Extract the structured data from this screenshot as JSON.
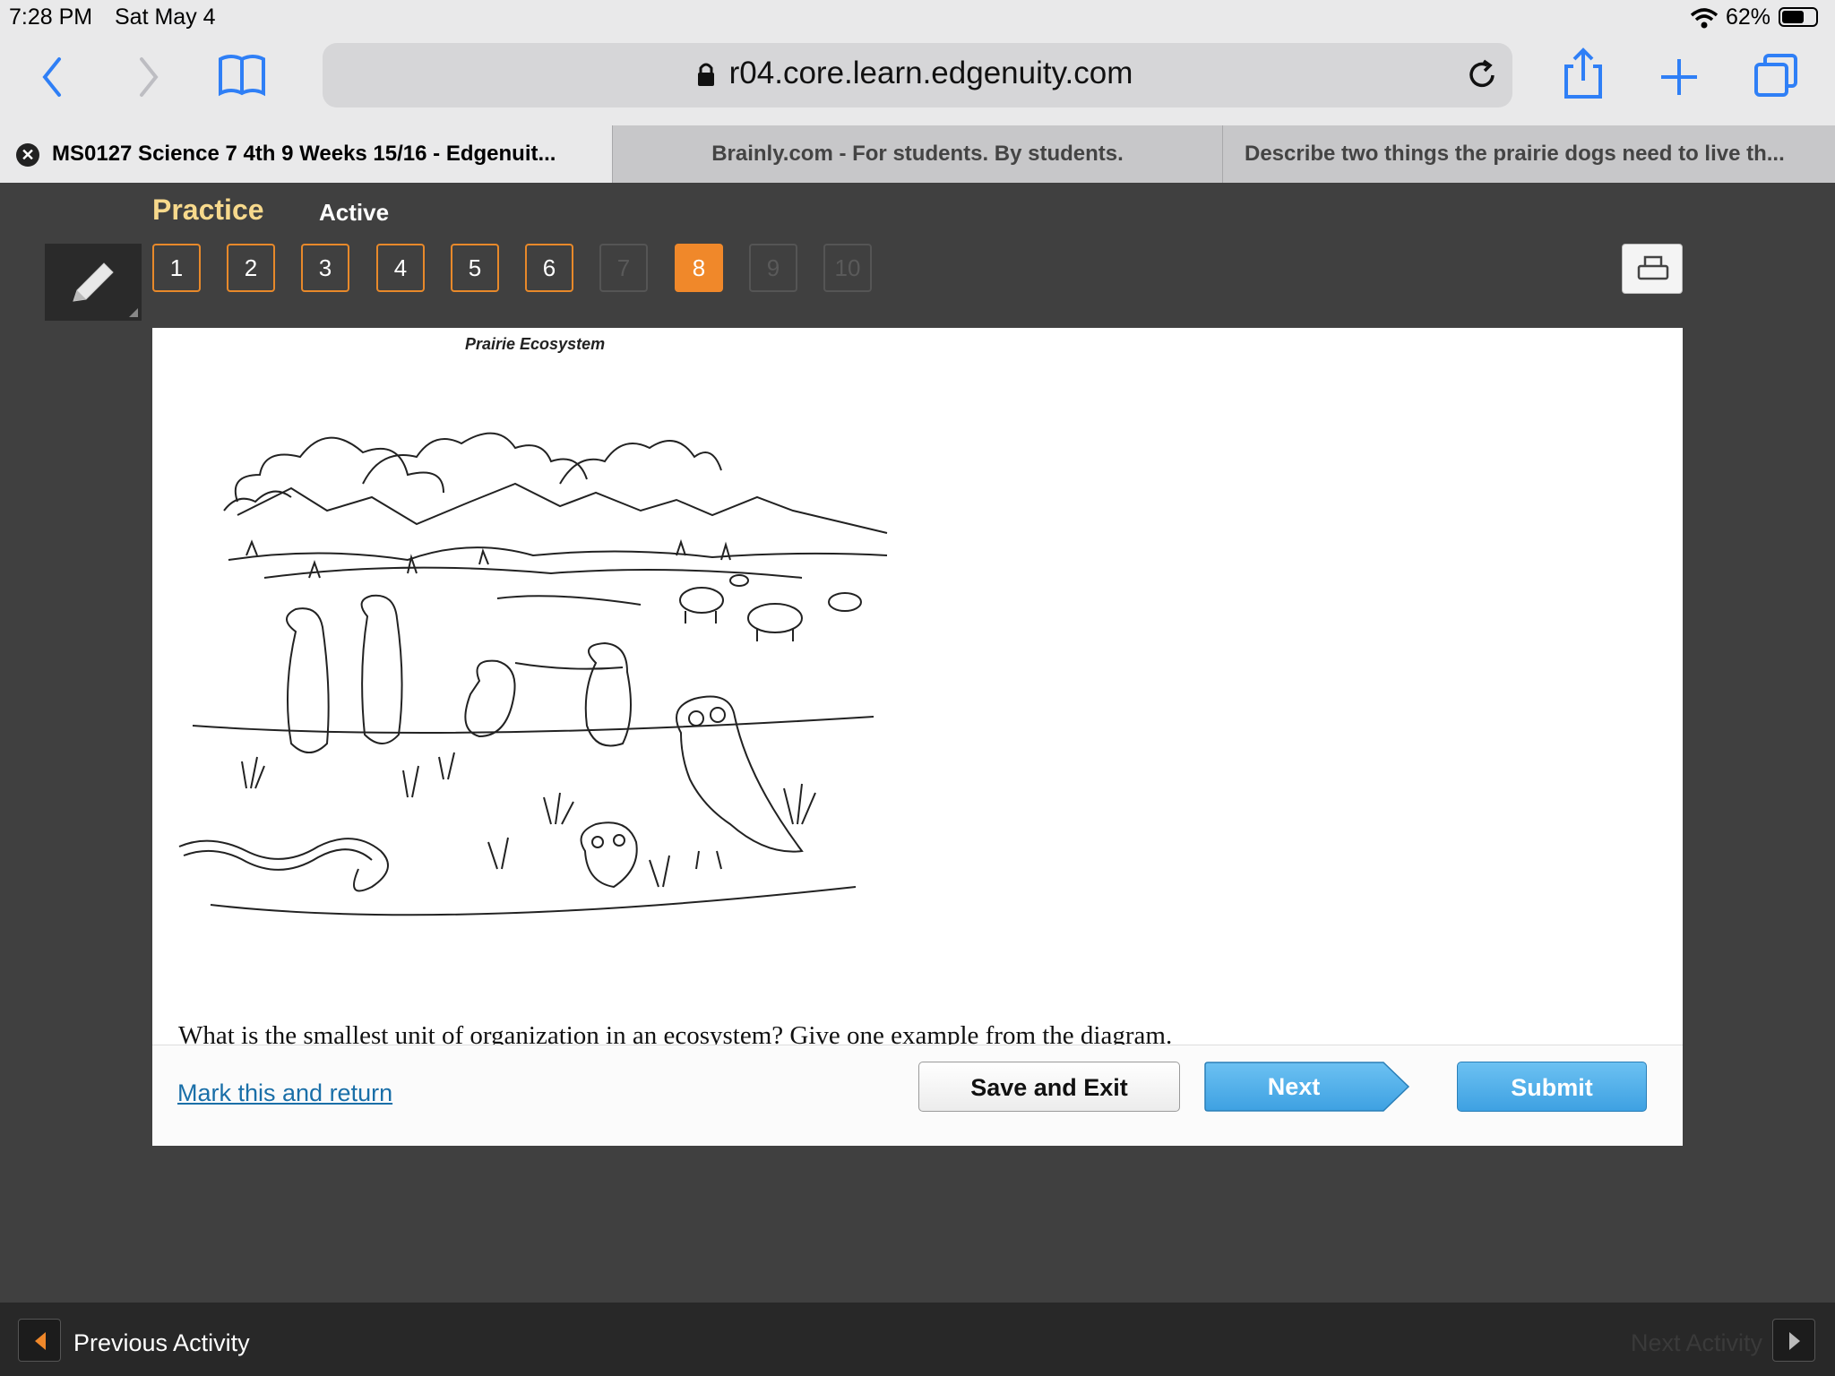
{
  "status_bar": {
    "time": "7:28 PM",
    "date": "Sat May 4",
    "battery": "62%"
  },
  "browser": {
    "url": "r04.core.learn.edgenuity.com",
    "tabs": [
      {
        "label": "MS0127 Science 7 4th 9 Weeks 15/16 - Edgenuit...",
        "active": true
      },
      {
        "label": "Brainly.com - For students. By students.",
        "active": false
      },
      {
        "label": "Describe two things the prairie dogs need to live th...",
        "active": false
      }
    ]
  },
  "header": {
    "mode": "Practice",
    "status": "Active"
  },
  "questions": {
    "numbers": [
      "1",
      "2",
      "3",
      "4",
      "5",
      "6",
      "7",
      "8",
      "9",
      "10"
    ],
    "current": "8"
  },
  "content": {
    "diagram_title": "Prairie Ecosystem",
    "question": "What is the smallest unit of organization in an ecosystem? Give one example from the diagram."
  },
  "footer": {
    "mark_return": "Mark this and return",
    "save_exit": "Save and Exit",
    "next": "Next",
    "submit": "Submit"
  },
  "bottom_nav": {
    "previous": "Previous Activity",
    "next": "Next Activity"
  },
  "colors": {
    "accent": "#f0882a",
    "link": "#1a6fa8",
    "ios_blue": "#2f7ff6",
    "button_blue": "#3ea1e2"
  }
}
